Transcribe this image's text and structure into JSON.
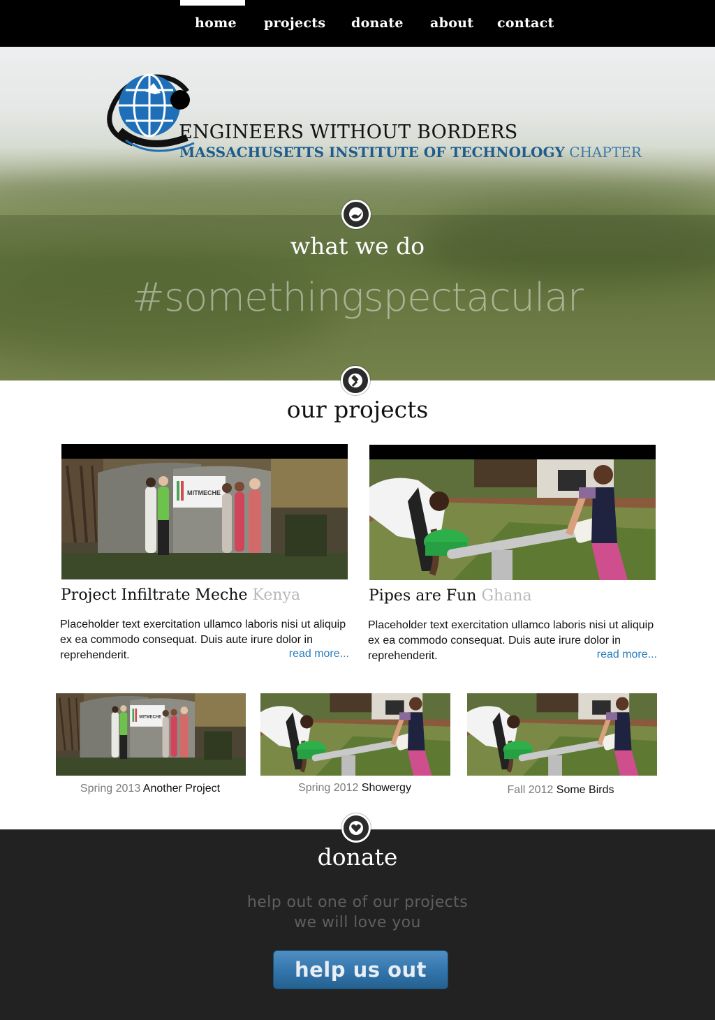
{
  "nav": {
    "items": [
      {
        "label": "home",
        "active": true
      },
      {
        "label": "projects"
      },
      {
        "label": "donate"
      },
      {
        "label": "about"
      },
      {
        "label": "contact"
      }
    ]
  },
  "hero": {
    "org_name": "ENGINEERS WITHOUT BORDERS",
    "org_chapter_bold": "MASSACHUSETTS INSTITUTE OF TECHNOLOGY",
    "org_chapter_light": "CHAPTER",
    "section_title": "what we do",
    "tagline": "#somethingspectacular"
  },
  "projects": {
    "section_title": "our projects",
    "featured": [
      {
        "title": "Project Infiltrate Meche",
        "location": "Kenya",
        "photo_sign_text": "MITMECHE",
        "description": "Placeholder text exercitation ullamco laboris nisi ut aliquip ex ea commodo consequat. Duis aute irure dolor in reprehenderit.",
        "link": "read more..."
      },
      {
        "title": "Pipes are Fun",
        "location": "Ghana",
        "description": "Placeholder text exercitation ullamco laboris nisi ut aliquip ex ea commodo consequat. Duis aute irure dolor in reprehenderit.",
        "link": "read more..."
      }
    ],
    "past": [
      {
        "term": "Spring 2013",
        "name": "Another Project",
        "photo_sign_text": "MITMECHE"
      },
      {
        "term": "Spring 2012",
        "name": "Showergy"
      },
      {
        "term": "Fall 2012",
        "name": "Some Birds"
      }
    ]
  },
  "donate": {
    "section_title": "donate",
    "line1": "help out one of our projects",
    "line2": "we will love you",
    "button_label": "help us out"
  },
  "icons": [
    "globe-logo-icon",
    "bird-icon",
    "gavel-icon",
    "heart-icon"
  ],
  "colors": {
    "nav_bg": "#000000",
    "brand_blue": "#1f5c8e",
    "link_blue": "#2a7dbd",
    "donate_bg": "#222222",
    "button_blue": "#3576ad"
  }
}
